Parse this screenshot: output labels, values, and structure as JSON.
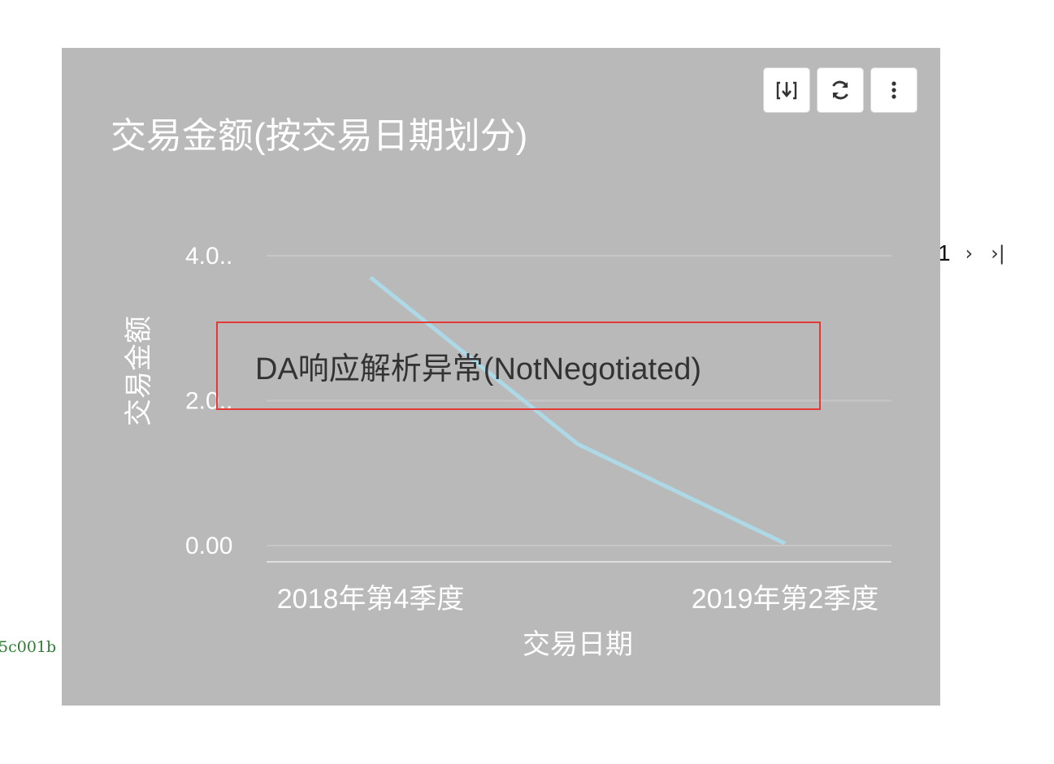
{
  "background": {
    "code_fragment": "5c001b"
  },
  "pager": {
    "current_page": "1",
    "next_label": "›",
    "last_label": "›|"
  },
  "card": {
    "title": "交易金额(按交易日期划分)",
    "toolbar": [
      {
        "name": "download-icon"
      },
      {
        "name": "refresh-icon"
      },
      {
        "name": "more-vertical-icon"
      }
    ],
    "error_message": "DA响应解析异常(NotNegotiated)"
  },
  "colors": {
    "card_background": "#b9b9b9",
    "line": "#add8e6",
    "error_border": "#e53935",
    "gridline": "#c8c8c8"
  },
  "chart_data": {
    "type": "line",
    "x_tick_labels": [
      "2018年第4季度",
      "2019年第2季度"
    ],
    "y_tick_labels": [
      "0.00",
      "2.0..",
      "4.0.."
    ],
    "y_ticks": [
      0,
      2,
      4
    ],
    "ylim": [
      0,
      4
    ],
    "xlabel": "交易日期",
    "ylabel": "交易金额",
    "series": [
      {
        "points": [
          {
            "x_index": 0,
            "y": 3.7
          },
          {
            "x_index": 1,
            "y": 1.4
          },
          {
            "x_index": 2,
            "y": 0.03
          }
        ]
      }
    ],
    "grid": true
  }
}
